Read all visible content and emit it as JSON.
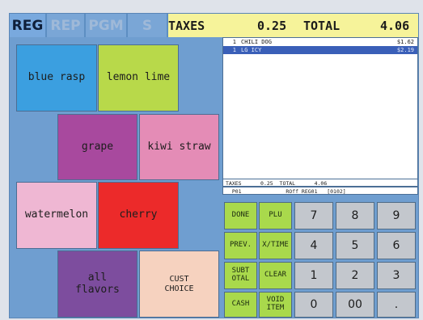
{
  "tabs": [
    {
      "label": "REG",
      "active": true
    },
    {
      "label": "REP",
      "active": false
    },
    {
      "label": "PGM",
      "active": false
    },
    {
      "label": "S",
      "active": false
    }
  ],
  "totals": {
    "taxes_label": "TAXES",
    "taxes_value": "0.25",
    "total_label": "TOTAL",
    "total_value": "4.06"
  },
  "flavors": [
    {
      "label": "blue rasp",
      "color": "#3b9fe0"
    },
    {
      "label": "lemon lime",
      "color": "#b8d94a"
    },
    {
      "label": "grape",
      "color": "#a8499e"
    },
    {
      "label": "kiwi straw",
      "color": "#e48cb6"
    },
    {
      "label": "watermelon",
      "color": "#efb7d3"
    },
    {
      "label": "cherry",
      "color": "#ec2a2a"
    },
    {
      "label": "all flavors",
      "color": "#7d4d9e"
    },
    {
      "label": "CUST CHOICE",
      "color": "#f6d2bf"
    }
  ],
  "receipt": {
    "items": [
      {
        "qty": "1",
        "name": "CHILI DOG",
        "price": "$1.62",
        "selected": false
      },
      {
        "qty": "1",
        "name": "LG ICY",
        "price": "$2.19",
        "selected": true
      }
    ],
    "summary_line": "TAXES      0.25  TOTAL      4.06",
    "status_line": "  P01              ROff REG01   [0102]"
  },
  "function_keys": [
    {
      "label": "DONE"
    },
    {
      "label": "PLU"
    },
    {
      "label": "PREV."
    },
    {
      "label": "X/TIME"
    },
    {
      "label": "SUBT OTAL"
    },
    {
      "label": "CLEAR"
    },
    {
      "label": "CASH"
    },
    {
      "label": "VOID ITEM"
    }
  ],
  "number_keys": [
    {
      "label": "7"
    },
    {
      "label": "8"
    },
    {
      "label": "9"
    },
    {
      "label": "4"
    },
    {
      "label": "5"
    },
    {
      "label": "6"
    },
    {
      "label": "1"
    },
    {
      "label": "2"
    },
    {
      "label": "3"
    },
    {
      "label": "0"
    },
    {
      "label": "00"
    },
    {
      "label": "."
    }
  ]
}
